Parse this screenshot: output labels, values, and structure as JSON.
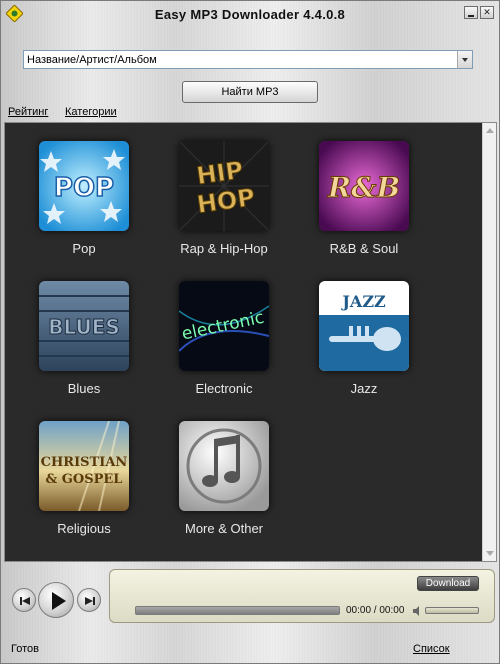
{
  "window": {
    "title": "Easy MP3 Downloader  4.4.0.8",
    "icons": {
      "app": "app-logo-icon",
      "minimize": "minimize-icon",
      "close": "close-icon"
    }
  },
  "search": {
    "selected": "Название/Артист/Альбом",
    "button_label": "Найти MP3"
  },
  "tabs": {
    "rating": "Рейтинг",
    "categories": "Категории"
  },
  "genres": [
    {
      "label": "Pop",
      "icon": "pop-art-icon"
    },
    {
      "label": "Rap & Hip-Hop",
      "icon": "hiphop-art-icon"
    },
    {
      "label": "R&B & Soul",
      "icon": "rnb-art-icon"
    },
    {
      "label": "Blues",
      "icon": "blues-art-icon"
    },
    {
      "label": "Electronic",
      "icon": "electronic-art-icon"
    },
    {
      "label": "Jazz",
      "icon": "jazz-art-icon"
    },
    {
      "label": "Religious",
      "icon": "religious-art-icon"
    },
    {
      "label": "More & Other",
      "icon": "itunes-note-icon"
    }
  ],
  "art_text": {
    "pop": "POP",
    "hiphop_1": "HIP",
    "hiphop_2": "HOP",
    "rnb": "R&B",
    "blues": "BLUES",
    "electronic": "electronic",
    "jazz": "JAZZ",
    "christian_1": "CHRISTIAN",
    "christian_2": "& GOSPEL"
  },
  "player": {
    "download_label": "Download",
    "time": "00:00 / 00:00",
    "progress": 0,
    "volume": 1.0
  },
  "status": {
    "left": "Готов",
    "right": "Список"
  },
  "colors": {
    "panel_bg": "#2a2a2a",
    "label_text": "#e8e8e8",
    "info_box": "#eae9d4"
  }
}
